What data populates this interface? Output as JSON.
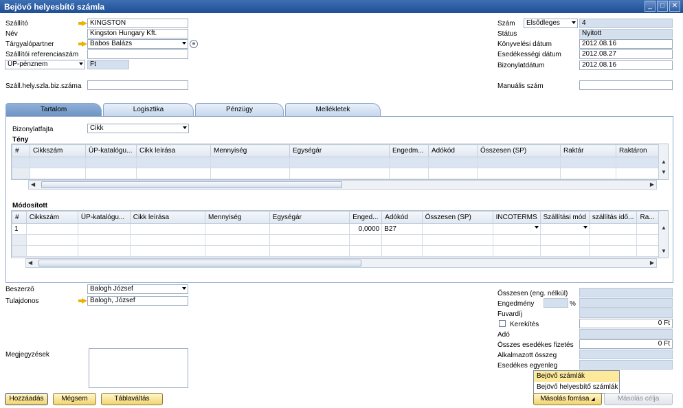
{
  "window": {
    "title": "Bejövő helyesbítő számla",
    "min": "_",
    "max": "□",
    "close": "✕"
  },
  "header_left": {
    "supplier": {
      "label": "Szállító",
      "value": "KINGSTON"
    },
    "name": {
      "label": "Név",
      "value": "Kingston Hungary Kft."
    },
    "contact": {
      "label": "Tárgyalópartner",
      "value": "Babos Balázs"
    },
    "supplier_ref": {
      "label": "Szállítói referenciaszám",
      "value": ""
    },
    "currency_type": {
      "value": "ÜP-pénznem",
      "currency": "Ft"
    },
    "supplier_corr_no": {
      "label": "Száll.hely.szla.biz.száma",
      "value": ""
    }
  },
  "header_right": {
    "number": {
      "label": "Szám",
      "series": "Elsődleges",
      "value": "4"
    },
    "status": {
      "label": "Státus",
      "value": "Nyitott"
    },
    "posting_date": {
      "label": "Könyvelési dátum",
      "value": "2012.08.16"
    },
    "due_date": {
      "label": "Esedékességi dátum",
      "value": "2012.08.27"
    },
    "doc_date": {
      "label": "Bizonylatdátum",
      "value": "2012.08.16"
    },
    "manual_no": {
      "label": "Manuális szám",
      "value": ""
    }
  },
  "tabs": [
    "Tartalom",
    "Logisztika",
    "Pénzügy",
    "Mellékletek"
  ],
  "doc_type": {
    "label": "Bizonylatfajta",
    "value": "Cikk"
  },
  "actual": {
    "title": "Tény",
    "columns": [
      "#",
      "Cikkszám",
      "ÜP-katalógu...",
      "Cikk leírása",
      "Mennyiség",
      "Egységár",
      "Engedm...",
      "Adókód",
      "Összesen (SP)",
      "Raktár",
      "Raktáron"
    ]
  },
  "modified": {
    "title": "Módosított",
    "columns": [
      "#",
      "Cikkszám",
      "ÜP-katalógu...",
      "Cikk leírása",
      "Mennyiség",
      "Egységár",
      "Enged...",
      "Adókód",
      "Összesen (SP)",
      "INCOTERMS",
      "Szállítási mód",
      "szállítás idő...",
      "Ra..."
    ],
    "row1": {
      "num": "1",
      "discount": "0,0000",
      "tax": "B27"
    }
  },
  "footer_left": {
    "buyer": {
      "label": "Beszerző",
      "value": "Balogh József"
    },
    "owner": {
      "label": "Tulajdonos",
      "value": "Balogh, József"
    },
    "remarks": {
      "label": "Megjegyzések",
      "value": ""
    }
  },
  "totals": {
    "total_before": {
      "label": "Összesen (eng. nélkül)",
      "value": ""
    },
    "discount": {
      "label": "Engedmény",
      "value": "",
      "pct": "%"
    },
    "freight": {
      "label": "Fuvardíj",
      "value": ""
    },
    "rounding": {
      "label": "Kerekítés",
      "value": "0 Ft"
    },
    "tax": {
      "label": "Adó",
      "value": ""
    },
    "total_due": {
      "label": "Összes esedékes fizetés",
      "value": "0 Ft"
    },
    "applied": {
      "label": "Alkalmazott összeg",
      "value": ""
    },
    "balance": {
      "label": "Esedékes egyenleg",
      "value": ""
    }
  },
  "buttons": {
    "add": "Hozzáadás",
    "cancel": "Mégsem",
    "table_switch": "Táblaváltás",
    "copy_from": "Másolás forrása",
    "copy_to": "Másolás célja"
  },
  "popup": [
    "Bejövő számlák",
    "Bejövő helyesbítő számlák"
  ]
}
